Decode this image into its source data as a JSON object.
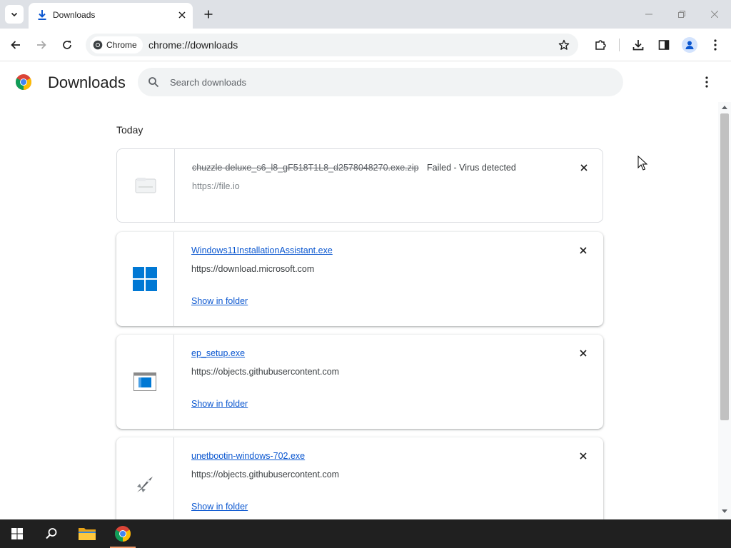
{
  "tab": {
    "title": "Downloads"
  },
  "omnibox": {
    "chip_label": "Chrome",
    "url": "chrome://downloads"
  },
  "page": {
    "title": "Downloads",
    "search_placeholder": "Search downloads"
  },
  "section_label": "Today",
  "downloads": [
    {
      "file_name": "chuzzle-deluxe_s6_l8_gF518T1L8_d2578048270.exe.zip",
      "status": "Failed - Virus detected",
      "url": "https://file.io",
      "icon": "generic-file-icon"
    },
    {
      "file_name": "Windows11InstallationAssistant.exe",
      "url": "https://download.microsoft.com",
      "action": "Show in folder",
      "icon": "windows-logo-icon"
    },
    {
      "file_name": "ep_setup.exe",
      "url": "https://objects.githubusercontent.com",
      "action": "Show in folder",
      "icon": "window-app-icon"
    },
    {
      "file_name": "unetbootin-windows-702.exe",
      "url": "https://objects.githubusercontent.com",
      "action": "Show in folder",
      "icon": "unetbootin-icon"
    }
  ],
  "colors": {
    "link": "#0b57d0",
    "tabbar": "#dee1e6",
    "omnibox": "#f1f3f4",
    "taskbar": "#202020",
    "windows_blue": "#0078d4"
  }
}
